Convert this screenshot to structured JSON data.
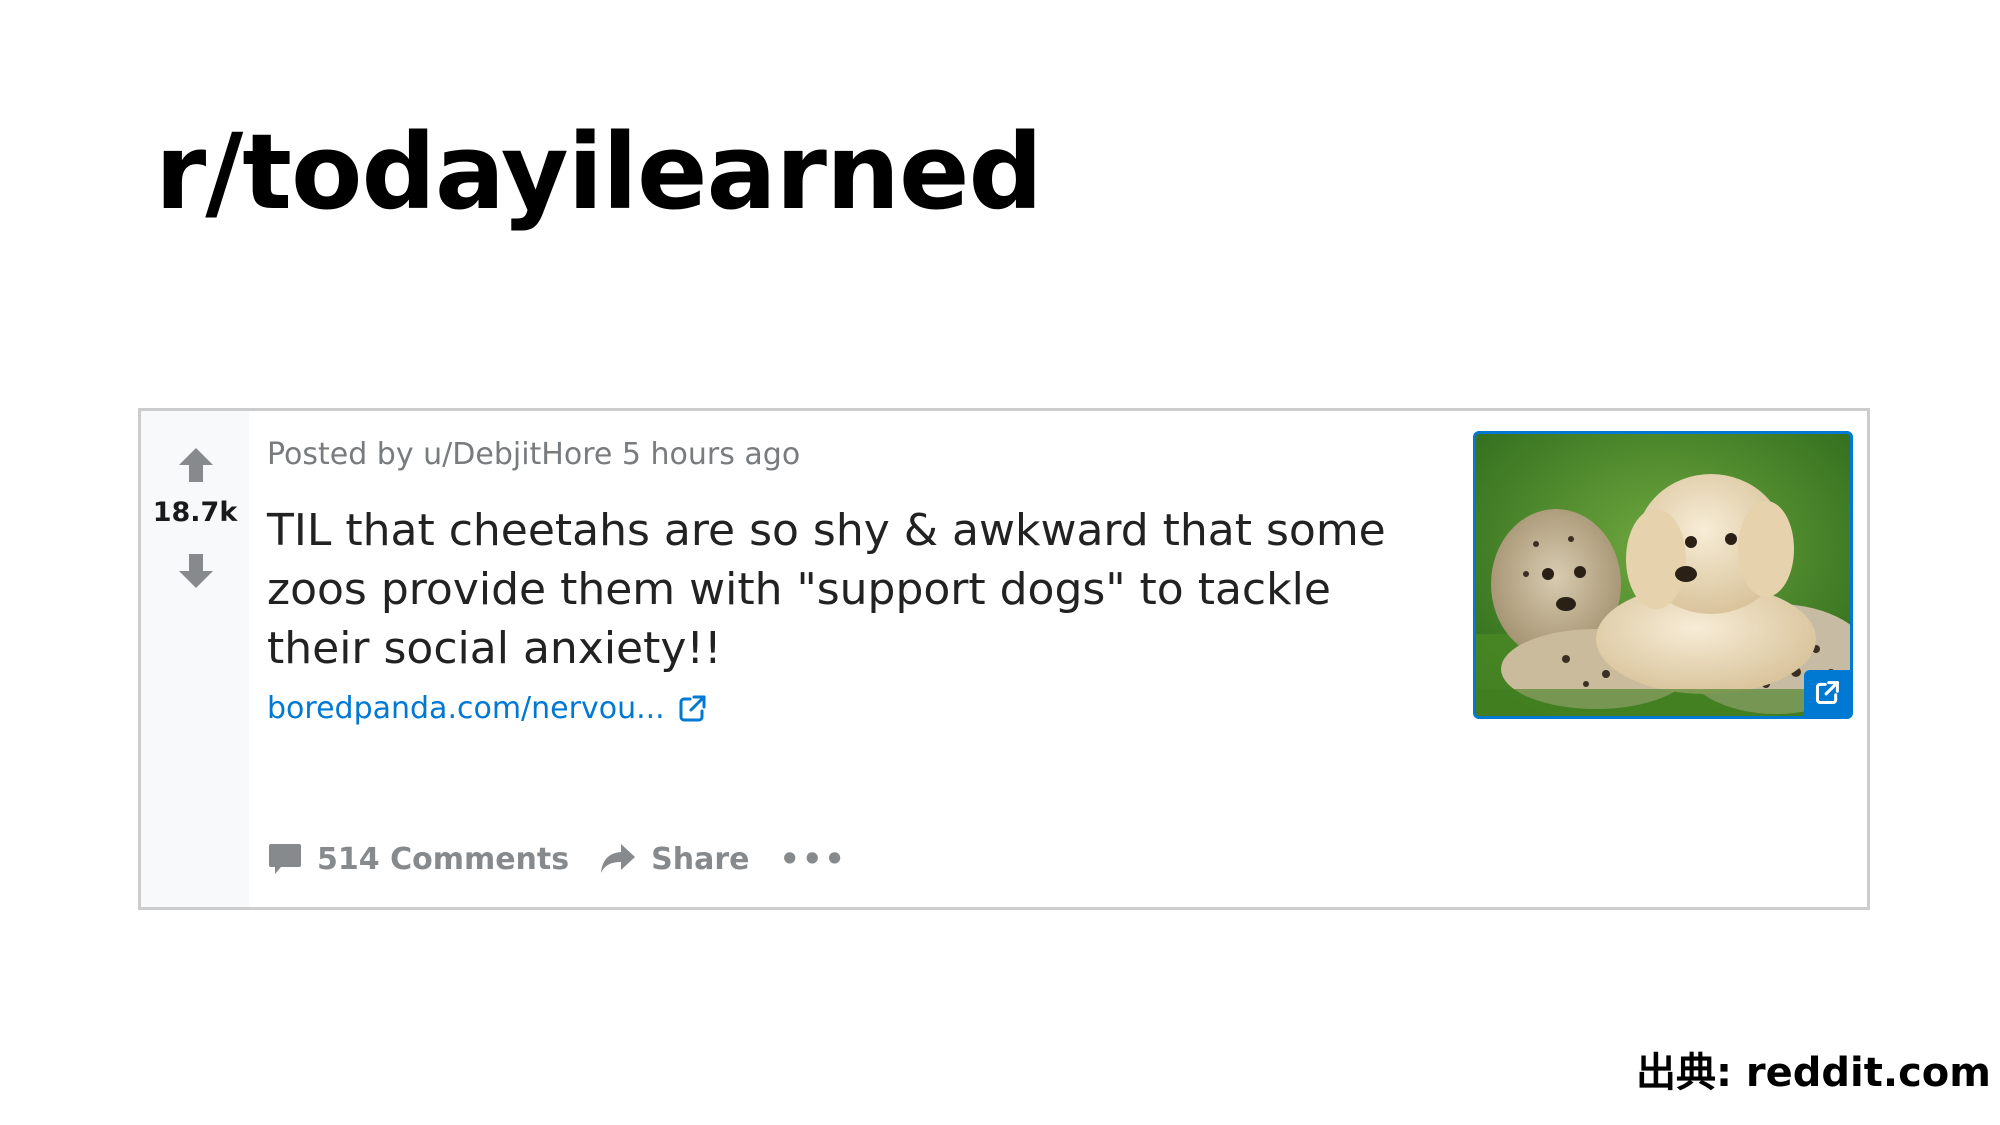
{
  "slide": {
    "title": "r/todayilearned",
    "source_credit": "出典: reddit.com"
  },
  "post": {
    "score": "18.7k",
    "meta": {
      "prefix": "Posted by",
      "author": "u/DebjitHore",
      "time": "5 hours ago"
    },
    "title": "TIL that cheetahs are so shy & awkward that some zoos provide them with \"support dogs\" to tackle their social anxiety!!",
    "link_text": "boredpanda.com/nervou...",
    "actions": {
      "comments": "514 Comments",
      "share": "Share",
      "more": "•••"
    },
    "thumbnail_alt": "cheetah cub and puppy on grass"
  },
  "icons": {
    "upvote": "arrow-up-icon",
    "downvote": "arrow-down-icon",
    "external": "external-link-icon",
    "comment": "comment-bubble-icon",
    "share": "share-arrow-icon",
    "more": "more-options-icon"
  },
  "colors": {
    "link_blue": "#0079d3",
    "muted_gray": "#878a8c",
    "vote_column_bg": "#f8f9fa",
    "card_border": "#cccccc"
  }
}
